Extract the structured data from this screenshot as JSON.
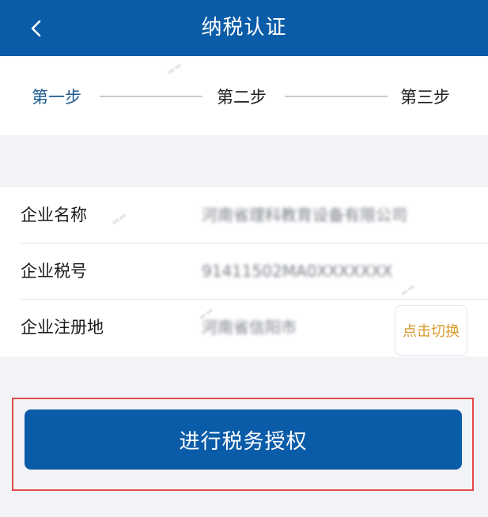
{
  "header": {
    "title": "纳税认证"
  },
  "steps": [
    {
      "label": "第一步",
      "active": true
    },
    {
      "label": "第二步",
      "active": false
    },
    {
      "label": "第三步",
      "active": false
    }
  ],
  "company": {
    "name_label": "企业名称",
    "name_value": "河南省理科教育设备有限公司",
    "tax_id_label": "企业税号",
    "tax_id_value": "91411502MA0XXXXXXX",
    "reg_label": "企业注册地",
    "reg_value": "河南省信阳市"
  },
  "switch_label": "点击切换",
  "auth_button_label": "进行税务授权",
  "colors": {
    "brand": "#0b5ca8",
    "active_step": "#1d5a8f",
    "switch_text": "#d99a2b",
    "highlight": "#e34a4a"
  }
}
